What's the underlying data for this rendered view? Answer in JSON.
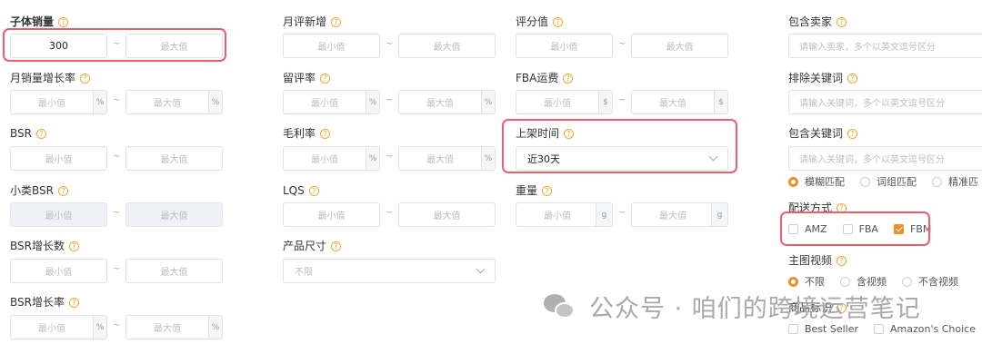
{
  "placeholders": {
    "min": "最小值",
    "max": "最大值"
  },
  "sep": "~",
  "col1": {
    "sales": {
      "label": "子体销量",
      "min_value": "300"
    },
    "monthly_growth": {
      "label": "月销量增长率",
      "unit": "%"
    },
    "bsr": {
      "label": "BSR"
    },
    "sub_bsr": {
      "label": "小类BSR"
    },
    "bsr_growth_count": {
      "label": "BSR增长数"
    },
    "bsr_growth_rate": {
      "label": "BSR增长率",
      "unit": "%"
    }
  },
  "col2": {
    "monthly_reviews": {
      "label": "月评新增"
    },
    "review_rate": {
      "label": "留评率",
      "unit": "%"
    },
    "margin": {
      "label": "毛利率",
      "unit": "%"
    },
    "lqs": {
      "label": "LQS"
    },
    "size": {
      "label": "产品尺寸",
      "value": "不限"
    }
  },
  "col3": {
    "rating": {
      "label": "评分值"
    },
    "fba_fee": {
      "label": "FBA运费",
      "unit": "$"
    },
    "listing_time": {
      "label": "上架时间",
      "value": "近30天"
    },
    "weight": {
      "label": "重量",
      "unit": "g"
    }
  },
  "col4": {
    "include_sellers": {
      "label": "包含卖家",
      "placeholder": "请输入卖家，多个以英文逗号区分"
    },
    "exclude_keywords": {
      "label": "排除关键词",
      "placeholder": "请输入关键词，多个以英文逗号区分"
    },
    "include_keywords": {
      "label": "包含关键词",
      "placeholder": "请输入关键词，多个以英文逗号区分"
    },
    "match_options": [
      "模糊匹配",
      "词组匹配",
      "精准匹"
    ],
    "delivery": {
      "label": "配送方式",
      "options": [
        "AMZ",
        "FBA",
        "FBM"
      ]
    },
    "main_video": {
      "label": "主图视频",
      "options": [
        "不限",
        "含视频",
        "不含视频"
      ]
    },
    "badge": {
      "label": "商品标识",
      "options": [
        "Best Seller",
        "Amazon's Choice"
      ]
    }
  },
  "watermark": "公众号 · 咱们的跨境运营笔记",
  "colors": {
    "accent": "#f08c2a",
    "highlight": "#ee5d6b"
  }
}
